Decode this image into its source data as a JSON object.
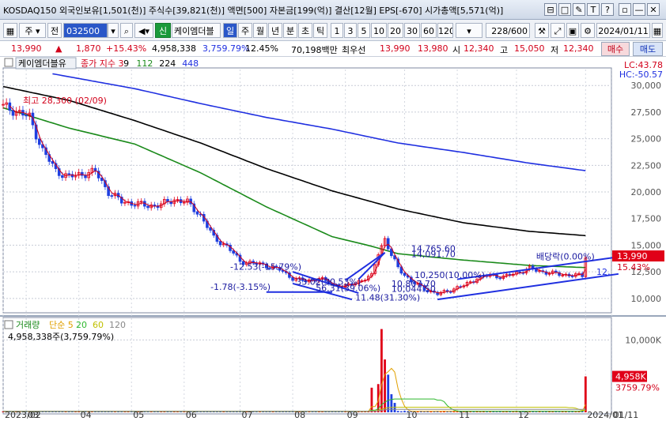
{
  "title_bar": {
    "text": "KOSDAQ150 외국인보유[1,501(천)] 주식수[39,821(천)] 액면[500] 자본금[199(억)] 결산[12월] EPS[-670] 시가총액[5,571(억)]",
    "buttons": [
      "⊟",
      "□",
      "✎",
      "T",
      "?",
      "▫",
      "—",
      "□",
      "✕"
    ]
  },
  "toolbar": {
    "code_prefix": "주",
    "mode": "전",
    "stock_code": "032500",
    "sin_badge": "신",
    "stock_name": "케이엠더블",
    "period_tabs": [
      "일",
      "주",
      "월",
      "년",
      "분",
      "초",
      "틱"
    ],
    "active_period": "일",
    "intervals": [
      "1",
      "3",
      "5",
      "10",
      "20",
      "30",
      "60",
      "120"
    ],
    "count": "228",
    "count_total": "/600",
    "date": "2024/01/11"
  },
  "quote_bar": {
    "price": "13,990",
    "change": "1,870",
    "change_pct": "+15.43%",
    "volume": "4,958,338",
    "volume_ratio": "3,759.79%",
    "turnover": "12.45%",
    "amount": "70,198백만",
    "best_ask_label": "최우선",
    "best_ask": "13,990",
    "best_bid": "13,980",
    "open_label": "시",
    "open": "12,340",
    "high_label": "고",
    "high": "15,050",
    "low_label": "저",
    "low": "12,340",
    "buy_label": "매수",
    "sell_label": "매도"
  },
  "chart_data": [
    {
      "type": "line",
      "title": "케이엠더블유",
      "legend": [
        {
          "name": "종가 지수 3",
          "color": "#d2001a"
        },
        {
          "name": "9",
          "color": "#000000"
        },
        {
          "name": "112",
          "color": "#1a8a1a"
        },
        {
          "name": "224",
          "color": "#000000"
        },
        {
          "name": "448",
          "color": "#1f2fe0"
        }
      ],
      "x_ticks": [
        "2023/02",
        "03",
        "04",
        "05",
        "06",
        "07",
        "08",
        "09",
        "10",
        "11",
        "12",
        "2024/01",
        "01/11"
      ],
      "x_tick_idx": [
        0,
        7,
        23,
        39,
        55,
        72,
        88,
        104,
        122,
        138,
        156,
        177,
        185
      ],
      "ylim": [
        8800,
        31500
      ],
      "y_ticks": [
        "30,000",
        "27,500",
        "25,000",
        "22,500",
        "20,000",
        "17,500",
        "15,000",
        "12,500",
        "10,000"
      ],
      "y_tick_vals": [
        30000,
        27500,
        25000,
        22500,
        20000,
        17500,
        15000,
        12500,
        10000
      ],
      "lc": "LC:43.78",
      "hc": "HC:-50.57",
      "current_price": "13,990",
      "current_pct": "15.43%",
      "current_value": 13990,
      "ma_axis_label": "12,",
      "ma_axis_value": 12500,
      "n_days": 178,
      "close_anchors": [
        [
          0,
          28000
        ],
        [
          4,
          27600
        ],
        [
          8,
          27000
        ],
        [
          12,
          23900
        ],
        [
          16,
          22000
        ],
        [
          20,
          21400
        ],
        [
          24,
          21700
        ],
        [
          28,
          21900
        ],
        [
          32,
          20000
        ],
        [
          36,
          19100
        ],
        [
          40,
          18900
        ],
        [
          44,
          18700
        ],
        [
          48,
          18800
        ],
        [
          52,
          19300
        ],
        [
          56,
          19000
        ],
        [
          60,
          17800
        ],
        [
          64,
          15700
        ],
        [
          68,
          14900
        ],
        [
          72,
          13500
        ],
        [
          76,
          13300
        ],
        [
          80,
          13100
        ],
        [
          84,
          12700
        ],
        [
          88,
          11900
        ],
        [
          92,
          11600
        ],
        [
          96,
          11900
        ],
        [
          100,
          11300
        ],
        [
          104,
          11100
        ],
        [
          108,
          11600
        ],
        [
          112,
          12100
        ],
        [
          114,
          14300
        ],
        [
          116,
          15600
        ],
        [
          118,
          14000
        ],
        [
          120,
          12900
        ],
        [
          124,
          11600
        ],
        [
          128,
          10900
        ],
        [
          132,
          10400
        ],
        [
          136,
          10800
        ],
        [
          140,
          11200
        ],
        [
          144,
          11900
        ],
        [
          148,
          12200
        ],
        [
          152,
          12000
        ],
        [
          156,
          12400
        ],
        [
          160,
          12800
        ],
        [
          164,
          12500
        ],
        [
          168,
          12300
        ],
        [
          172,
          12200
        ],
        [
          176,
          12120
        ],
        [
          177,
          13990
        ]
      ],
      "ma112_anchors": [
        [
          0,
          27900
        ],
        [
          20,
          26000
        ],
        [
          40,
          24500
        ],
        [
          60,
          21800
        ],
        [
          80,
          18600
        ],
        [
          100,
          15800
        ],
        [
          112,
          14900
        ],
        [
          120,
          14200
        ],
        [
          140,
          13600
        ],
        [
          160,
          13100
        ],
        [
          177,
          12900
        ]
      ],
      "ma224_anchors": [
        [
          0,
          29900
        ],
        [
          20,
          28600
        ],
        [
          40,
          26700
        ],
        [
          60,
          24600
        ],
        [
          80,
          22200
        ],
        [
          100,
          20100
        ],
        [
          120,
          18400
        ],
        [
          140,
          17100
        ],
        [
          160,
          16300
        ],
        [
          177,
          15900
        ]
      ],
      "ma448_anchors": [
        [
          15,
          31100
        ],
        [
          40,
          29700
        ],
        [
          60,
          28300
        ],
        [
          80,
          27000
        ],
        [
          100,
          25900
        ],
        [
          120,
          24600
        ],
        [
          140,
          23700
        ],
        [
          160,
          22700
        ],
        [
          177,
          22000
        ]
      ],
      "trendlines": [
        [
          [
            88,
            11400
          ],
          [
            106,
            9900
          ]
        ],
        [
          [
            88,
            12500
          ],
          [
            108,
            10500
          ]
        ],
        [
          [
            80,
            10600
          ],
          [
            100,
            10600
          ]
        ],
        [
          [
            104,
            11700
          ],
          [
            116,
            14300
          ]
        ],
        [
          [
            116,
            14300
          ],
          [
            108,
            11800
          ]
        ],
        [
          [
            132,
            9900
          ],
          [
            187,
            12300
          ]
        ],
        [
          [
            138,
            11800
          ],
          [
            187,
            13900
          ]
        ]
      ],
      "annotations": [
        {
          "text": "최고 28,300 (02/09)",
          "x": 6,
          "y": 28300,
          "color": "#d2001a"
        },
        {
          "text": "-12.53(-15.79%)",
          "x": 69,
          "y": 12700
        },
        {
          "text": "-1.78(-3.15%)",
          "x": 63,
          "y": 10800
        },
        {
          "text": "33.02(30.53%)",
          "x": 89,
          "y": 11300
        },
        {
          "text": "56.31(39.06%)",
          "x": 95,
          "y": 10700
        },
        {
          "text": "14,765.60",
          "x": 124,
          "y": 14400
        },
        {
          "text": "14,091.70",
          "x": 124,
          "y": 13900
        },
        {
          "text": "10,250(10.00%)",
          "x": 125,
          "y": 11900
        },
        {
          "text": "10,807.70",
          "x": 118,
          "y": 11100
        },
        {
          "text": "10,044.50",
          "x": 118,
          "y": 10600
        },
        {
          "text": "11.48(31.30%)",
          "x": 107,
          "y": 9800
        },
        {
          "text": "배당락(0.00%)",
          "x": 162,
          "y": 13650
        }
      ]
    },
    {
      "type": "bar",
      "title": "거래량",
      "legend": [
        {
          "name": "단순 5",
          "color": "#e0a000"
        },
        {
          "name": "20",
          "color": "#2fb82f"
        },
        {
          "name": "60",
          "color": "#c0c000"
        },
        {
          "name": "120",
          "color": "#888888"
        }
      ],
      "value_text": "4,958,338주(3,759.79%)",
      "ylim": [
        0,
        12000
      ],
      "y_ticks": [
        "10,000K"
      ],
      "y_tick_vals": [
        10000
      ],
      "current_label": "4,958K",
      "current_pct": "3759.79%",
      "current_value": 4958,
      "spikes": [
        [
          112,
          3400
        ],
        [
          114,
          3900
        ],
        [
          115,
          11500
        ],
        [
          116,
          7300
        ],
        [
          117,
          5200
        ],
        [
          118,
          2500
        ],
        [
          119,
          1300
        ],
        [
          177,
          4958
        ]
      ],
      "base_volume": 130
    }
  ]
}
